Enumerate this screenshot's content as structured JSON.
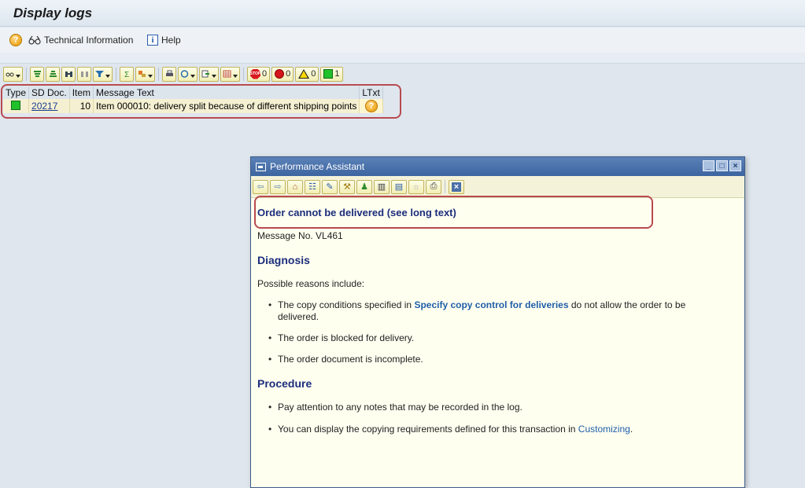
{
  "window": {
    "title": "Display logs"
  },
  "app_toolbar": {
    "technical_info_label": "Technical Information",
    "help_label": "Help"
  },
  "alv_toolbar": {
    "error_count": "0",
    "abort_count": "0",
    "warning_count": "0",
    "success_count": "1"
  },
  "grid": {
    "columns": [
      "Type",
      "SD Doc.",
      "Item",
      "Message Text",
      "LTxt"
    ],
    "rows": [
      {
        "type_status": "success",
        "sd_doc": "20217",
        "item": "10",
        "message": "Item 000010: delivery split because of different shipping points"
      }
    ]
  },
  "performance_assistant": {
    "title": "Performance Assistant",
    "heading": "Order cannot be delivered (see long text)",
    "message_no": "Message No. VL461",
    "diagnosis_title": "Diagnosis",
    "diagnosis_intro": "Possible reasons include:",
    "bullet1_pre": "The copy conditions specified in ",
    "bullet1_link": "Specify copy control for deliveries",
    "bullet1_post": " do not allow the order to be delivered.",
    "bullet2": "The order is blocked for delivery.",
    "bullet3": "The order document is incomplete.",
    "procedure_title": "Procedure",
    "proc_bullet1": "Pay attention to any notes that may be recorded in the log.",
    "proc_bullet2_pre": "You can display the copying requirements defined for this transaction in ",
    "proc_bullet2_link": "Customizing",
    "proc_bullet2_post": "."
  },
  "colors": {
    "heading_blue": "#1c2d7c",
    "link_blue": "#1f5ea8",
    "highlight_red": "#b84a4f",
    "assistant_bg": "#fffff0"
  }
}
